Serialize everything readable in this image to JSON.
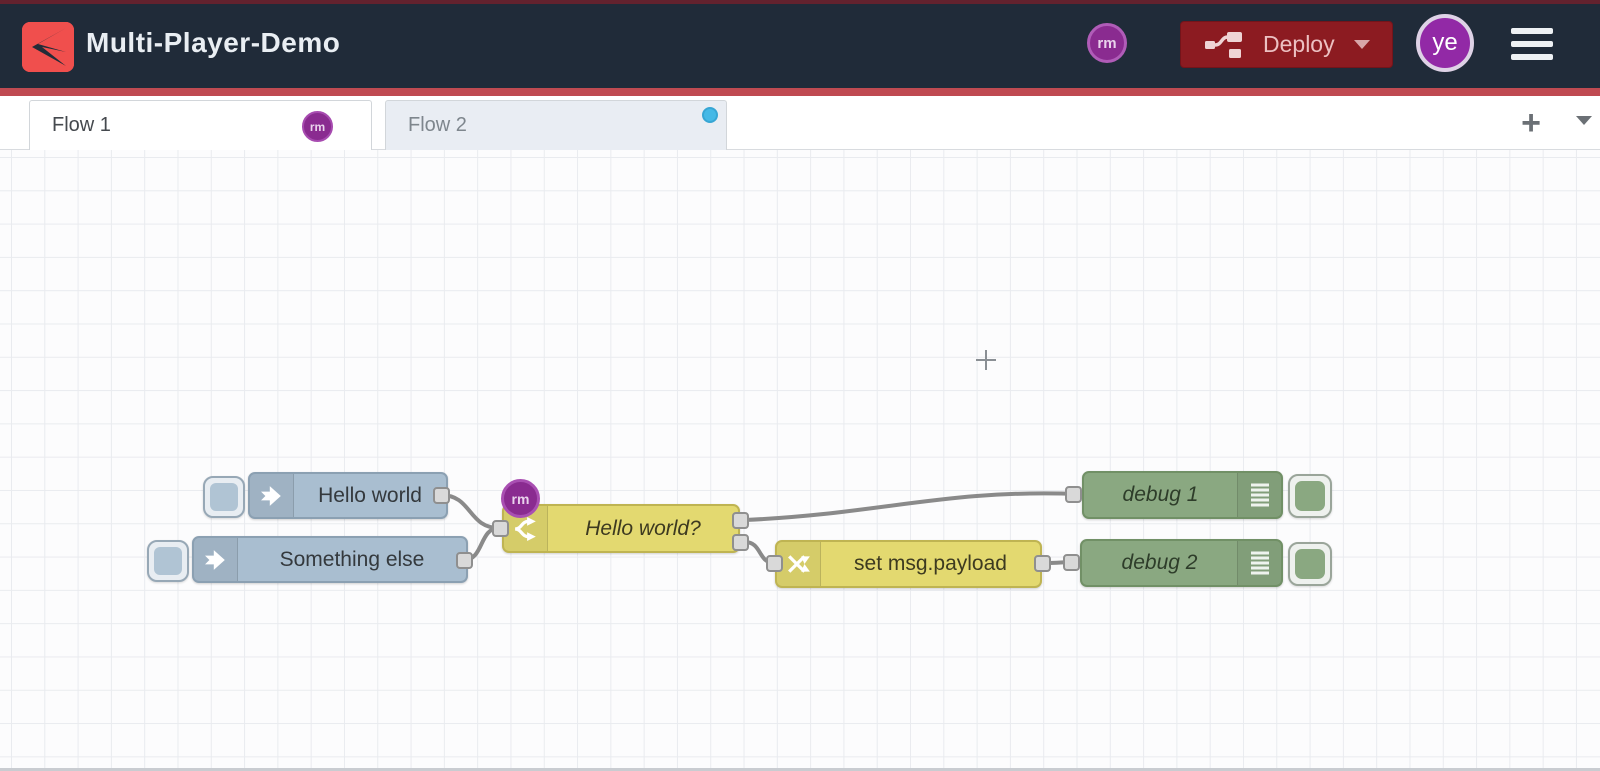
{
  "header": {
    "title": "Multi-Player-Demo",
    "presence_badge": "rm",
    "deploy": {
      "label": "Deploy"
    },
    "avatar": "ye"
  },
  "tabs": {
    "flow1": {
      "label": "Flow 1",
      "badge": "rm",
      "active": true
    },
    "flow2": {
      "label": "Flow 2",
      "active": false,
      "has_notification": true
    },
    "add_button": "+"
  },
  "canvas": {
    "nodes": {
      "inject1": {
        "type": "inject",
        "label": "Hello world"
      },
      "inject2": {
        "type": "inject",
        "label": "Something else"
      },
      "switch1": {
        "type": "switch",
        "label": "Hello world?",
        "badge": "rm"
      },
      "change1": {
        "type": "change",
        "label": "set msg.payload"
      },
      "debug1": {
        "type": "debug",
        "label": "debug 1"
      },
      "debug2": {
        "type": "debug",
        "label": "debug 2"
      }
    },
    "connections": [
      {
        "from": "inject1",
        "to": "switch1"
      },
      {
        "from": "inject2",
        "to": "switch1"
      },
      {
        "from": "switch1.output1",
        "to": "debug1"
      },
      {
        "from": "switch1.output2",
        "to": "change1"
      },
      {
        "from": "change1",
        "to": "debug2"
      }
    ]
  },
  "colors": {
    "header_bg": "#202b39",
    "accent_red_line": "#bf4a51",
    "logo_red": "#f04f4d",
    "deploy_button_red": "#8c1b21",
    "presence_purple": "#8a2b90",
    "inject_node_blue": "#a9bed0",
    "function_node_yellow": "#e3d970",
    "debug_node_green": "#8aa881",
    "wire_grey": "#8a8a8a",
    "tab_notification_blue": "#45b9e6"
  }
}
